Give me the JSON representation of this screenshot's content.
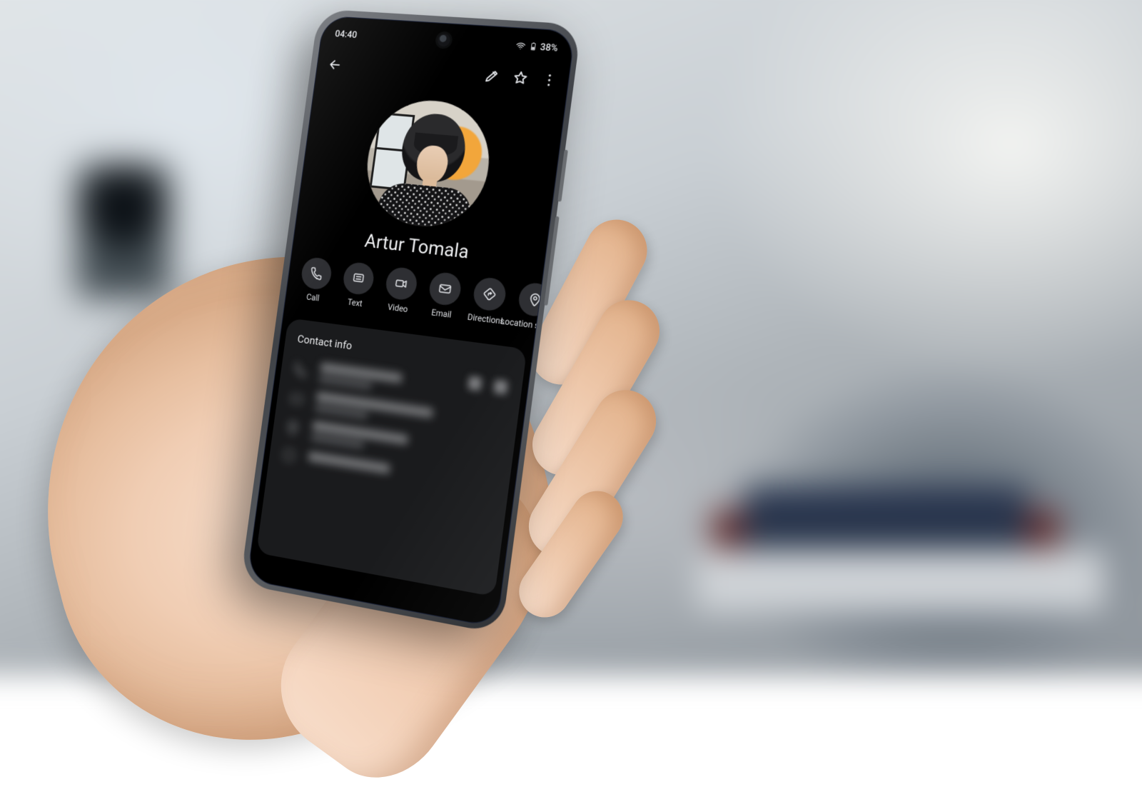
{
  "status": {
    "time": "04:40",
    "battery_percent": "38%"
  },
  "contact": {
    "name": "Artur Tomala"
  },
  "actions": [
    {
      "id": "call",
      "label": "Call",
      "icon": "phone"
    },
    {
      "id": "text",
      "label": "Text",
      "icon": "message"
    },
    {
      "id": "video",
      "label": "Video",
      "icon": "video"
    },
    {
      "id": "email",
      "label": "Email",
      "icon": "email"
    },
    {
      "id": "directions",
      "label": "Directions",
      "icon": "directions"
    },
    {
      "id": "loc-share",
      "label": "Location sharing",
      "icon": "location"
    }
  ],
  "section": {
    "contact_info_title": "Contact info"
  }
}
